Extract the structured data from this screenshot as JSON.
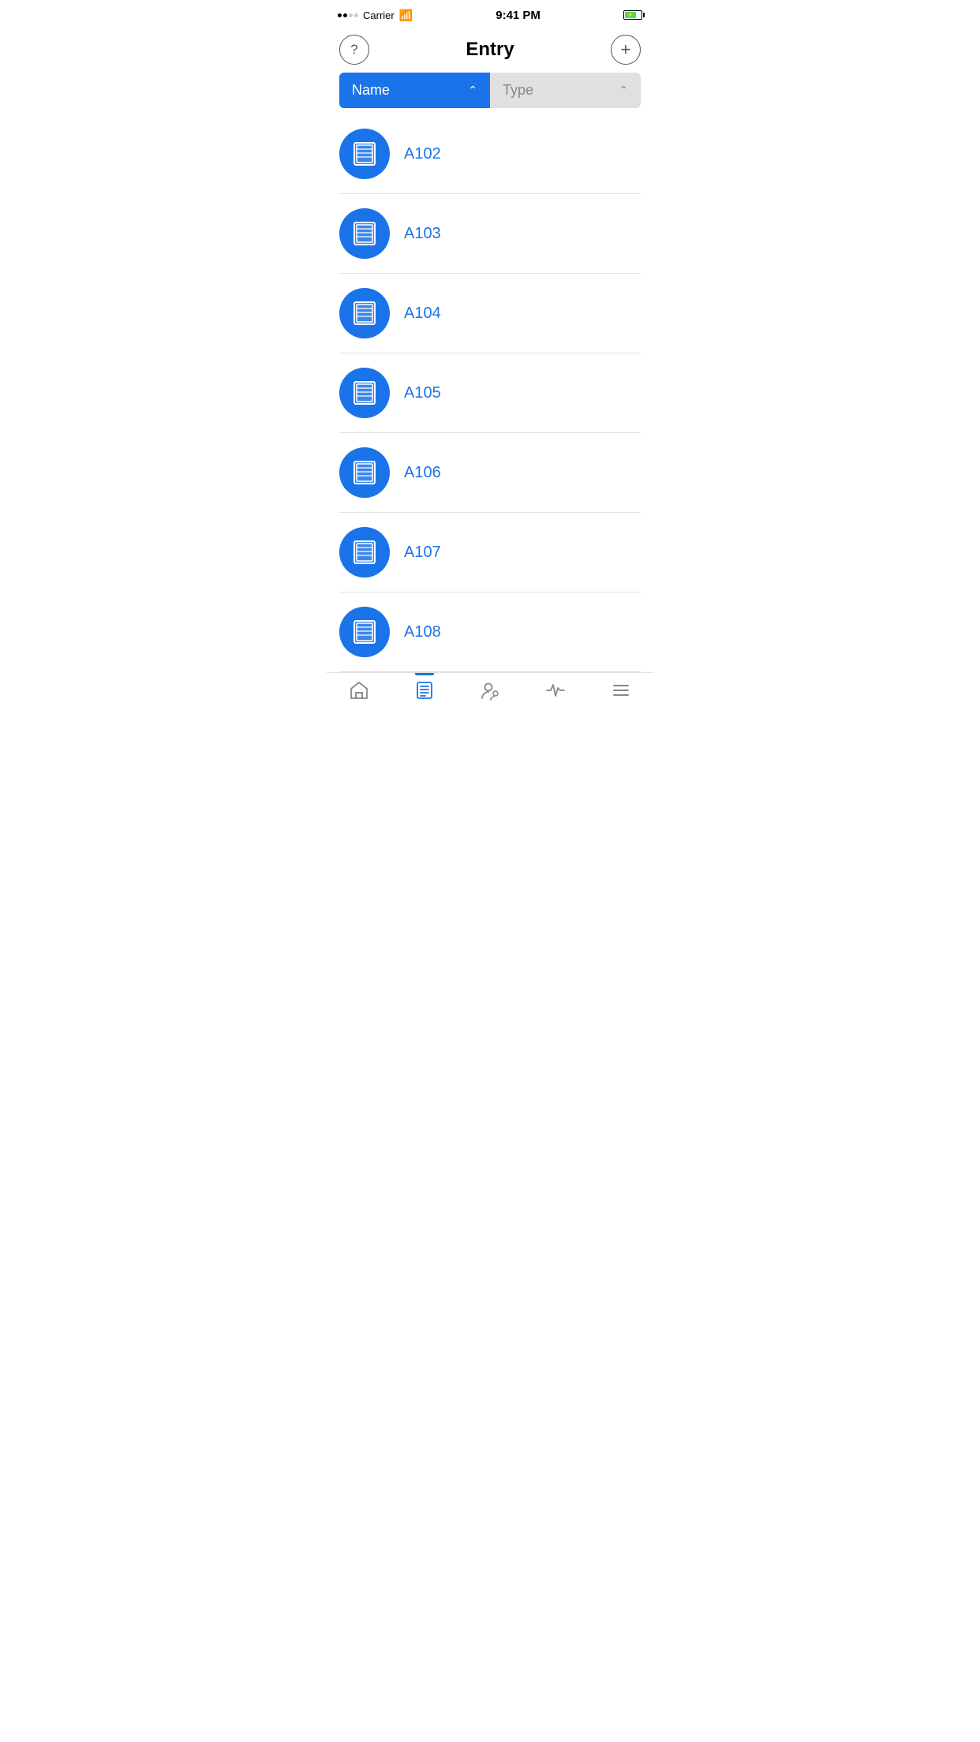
{
  "statusBar": {
    "carrier": "Carrier",
    "time": "9:41 PM"
  },
  "header": {
    "title": "Entry",
    "helpLabel": "?",
    "addLabel": "+"
  },
  "sortButtons": [
    {
      "id": "name",
      "label": "Name",
      "active": true
    },
    {
      "id": "type",
      "label": "Type",
      "active": false
    }
  ],
  "entries": [
    {
      "id": "A102",
      "label": "A102"
    },
    {
      "id": "A103",
      "label": "A103"
    },
    {
      "id": "A104",
      "label": "A104"
    },
    {
      "id": "A105",
      "label": "A105"
    },
    {
      "id": "A106",
      "label": "A106"
    },
    {
      "id": "A107",
      "label": "A107"
    },
    {
      "id": "A108",
      "label": "A108"
    }
  ],
  "tabs": [
    {
      "id": "home",
      "label": "Home",
      "active": false
    },
    {
      "id": "entries",
      "label": "Entries",
      "active": true
    },
    {
      "id": "users",
      "label": "Users",
      "active": false
    },
    {
      "id": "activity",
      "label": "Activity",
      "active": false
    },
    {
      "id": "menu",
      "label": "Menu",
      "active": false
    }
  ]
}
